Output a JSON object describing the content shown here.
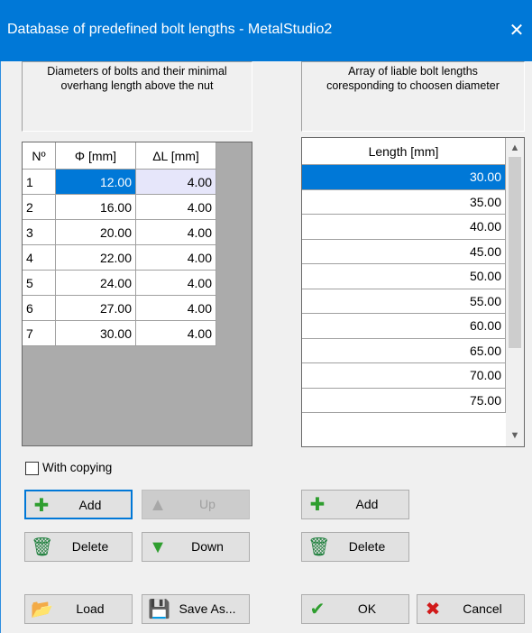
{
  "window": {
    "title": "Database of predefined bolt lengths - MetalStudio2",
    "close_glyph": "✕"
  },
  "left_panel": {
    "header": "Diameters of bolts and their minimal\noverhang length above the nut"
  },
  "right_panel": {
    "header": "Array of liable bolt lengths\ncoresponding to choosen diameter"
  },
  "bolts_table": {
    "columns": [
      "Nº",
      "Φ [mm]",
      "ΔL [mm]"
    ],
    "rows": [
      {
        "no": "1",
        "diameter": "12.00",
        "delta": "4.00"
      },
      {
        "no": "2",
        "diameter": "16.00",
        "delta": "4.00"
      },
      {
        "no": "3",
        "diameter": "20.00",
        "delta": "4.00"
      },
      {
        "no": "4",
        "diameter": "22.00",
        "delta": "4.00"
      },
      {
        "no": "5",
        "diameter": "24.00",
        "delta": "4.00"
      },
      {
        "no": "6",
        "diameter": "27.00",
        "delta": "4.00"
      },
      {
        "no": "7",
        "diameter": "30.00",
        "delta": "4.00"
      }
    ]
  },
  "lengths_table": {
    "column": "Length [mm]",
    "rows": [
      "30.00",
      "35.00",
      "40.00",
      "45.00",
      "50.00",
      "55.00",
      "60.00",
      "65.00",
      "70.00",
      "75.00"
    ]
  },
  "with_copying": {
    "label": "With copying",
    "checked": false
  },
  "buttons": {
    "left_add": "Add",
    "up": "Up",
    "left_delete": "Delete",
    "down": "Down",
    "load": "Load",
    "save_as": "Save As...",
    "right_add": "Add",
    "right_delete": "Delete",
    "ok": "OK",
    "cancel": "Cancel"
  },
  "colors": {
    "title_bar": "#0078d7",
    "selection": "#0078d7",
    "add_icon": "#2f9e2f",
    "delete_icon": "#1e7f3c",
    "cancel_icon": "#d11a1a"
  }
}
